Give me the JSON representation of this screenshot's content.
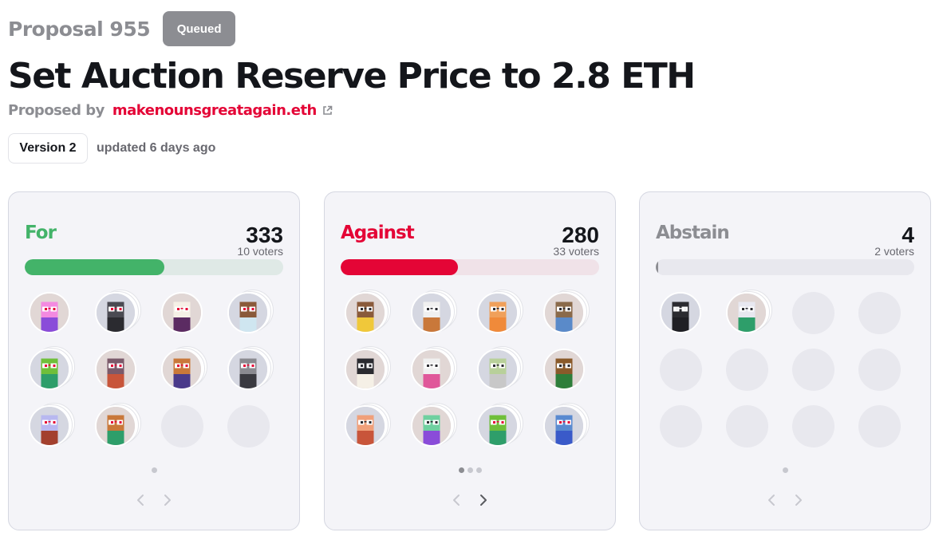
{
  "proposal": {
    "number_label": "Proposal 955",
    "status": "Queued",
    "title": "Set Auction Reserve Price to 2.8 ETH",
    "proposed_by_label": "Proposed by",
    "proposer": "makenounsgreatagain.eth",
    "version_label": "Version 2",
    "updated_text": "updated 6 days ago"
  },
  "colors": {
    "for": "#43b369",
    "for_track": "#dfe9e6",
    "against": "#e40536",
    "against_track": "#f0e2e8",
    "abstain": "#8c8d92",
    "abstain_track": "#e8e8ee"
  },
  "cards": [
    {
      "label": "For",
      "count": "333",
      "voters": "10 voters",
      "progress": 0.54,
      "dots_total": 1,
      "dots_active": 0,
      "prev_enabled": false,
      "next_enabled": false,
      "avatars": [
        {
          "bg": "#e1d7d5",
          "head": "#f38ae0",
          "body": "#8a4cd9",
          "stacked": false,
          "eyes": "#e40536"
        },
        {
          "bg": "#d5d7e1",
          "head": "#4a4a52",
          "body": "#2b2b30",
          "stacked": true,
          "eyes": "#e40536"
        },
        {
          "bg": "#e1d7d5",
          "head": "#f5f0e6",
          "body": "#5b2b62",
          "stacked": false,
          "eyes": "#e40536"
        },
        {
          "bg": "#d5d7e1",
          "head": "#8a5a3a",
          "body": "#cfe6f0",
          "stacked": true,
          "eyes": "#e40536"
        },
        {
          "bg": "#d5d7e1",
          "head": "#6fbf3a",
          "body": "#2e9e6a",
          "stacked": true,
          "eyes": "#e40536"
        },
        {
          "bg": "#e1d7d5",
          "head": "#7a5a6a",
          "body": "#c8553a",
          "stacked": false,
          "eyes": "#e40536"
        },
        {
          "bg": "#e1d7d5",
          "head": "#c9783a",
          "body": "#4a3a8a",
          "stacked": true,
          "eyes": "#e40536"
        },
        {
          "bg": "#d5d7e1",
          "head": "#8a8a90",
          "body": "#3a3a40",
          "stacked": true,
          "eyes": "#e40536"
        },
        {
          "bg": "#d5d7e1",
          "head": "#b8b8f0",
          "body": "#a3402e",
          "stacked": true,
          "eyes": "#e40536"
        },
        {
          "bg": "#e1d7d5",
          "head": "#c9783a",
          "body": "#2e9e6a",
          "stacked": true,
          "eyes": "#e40536"
        }
      ],
      "empty_slots": 2
    },
    {
      "label": "Against",
      "count": "280",
      "voters": "33 voters",
      "progress": 0.455,
      "dots_total": 3,
      "dots_active": 0,
      "prev_enabled": false,
      "next_enabled": true,
      "avatars": [
        {
          "bg": "#e1d7d5",
          "head": "#8a5a3a",
          "body": "#f0c83a",
          "stacked": true,
          "eyes": "#2b2b30"
        },
        {
          "bg": "#d5d7e1",
          "head": "#f0f0f0",
          "body": "#c9783a",
          "stacked": true,
          "eyes": "#2b2b30"
        },
        {
          "bg": "#d5d7e1",
          "head": "#f0a05a",
          "body": "#f08a3a",
          "stacked": true,
          "eyes": "#2b2b30"
        },
        {
          "bg": "#e1d7d5",
          "head": "#8a6a4a",
          "body": "#5a8ac9",
          "stacked": true,
          "eyes": "#2b2b30"
        },
        {
          "bg": "#e1d7d5",
          "head": "#2b2b30",
          "body": "#f5f0e6",
          "stacked": true,
          "eyes": "#2b2b30"
        },
        {
          "bg": "#e1d7d5",
          "head": "#f0f0f0",
          "body": "#e0589a",
          "stacked": true,
          "eyes": "#2b2b30"
        },
        {
          "bg": "#d5d7e1",
          "head": "#b8d09a",
          "body": "#c8c8c8",
          "stacked": true,
          "eyes": "#2b2b30"
        },
        {
          "bg": "#e1d7d5",
          "head": "#8a5a2a",
          "body": "#2e7e3a",
          "stacked": false,
          "eyes": "#2b2b30"
        },
        {
          "bg": "#d5d7e1",
          "head": "#f0a07a",
          "body": "#c8553a",
          "stacked": true,
          "eyes": "#2b2b30"
        },
        {
          "bg": "#e1d7d5",
          "head": "#6fd0a0",
          "body": "#8a4cd9",
          "stacked": true,
          "eyes": "#2b2b30"
        },
        {
          "bg": "#d5d7e1",
          "head": "#6fbf3a",
          "body": "#2e9e6a",
          "stacked": true,
          "eyes": "#e40536"
        },
        {
          "bg": "#d5d7e1",
          "head": "#5a8ad0",
          "body": "#3a5ac9",
          "stacked": true,
          "eyes": "#e40536"
        }
      ],
      "empty_slots": 0
    },
    {
      "label": "Abstain",
      "count": "4",
      "voters": "2 voters",
      "progress": 0.008,
      "dots_total": 1,
      "dots_active": 0,
      "prev_enabled": false,
      "next_enabled": false,
      "avatars": [
        {
          "bg": "#d5d7e1",
          "head": "#2b2b30",
          "body": "#1f1f24",
          "stacked": false,
          "eyes": "#f0f0f0"
        },
        {
          "bg": "#e1d7d5",
          "head": "#e8e8f0",
          "body": "#2e9e6a",
          "stacked": true,
          "eyes": "#2b2b30"
        }
      ],
      "empty_slots": 10
    }
  ]
}
